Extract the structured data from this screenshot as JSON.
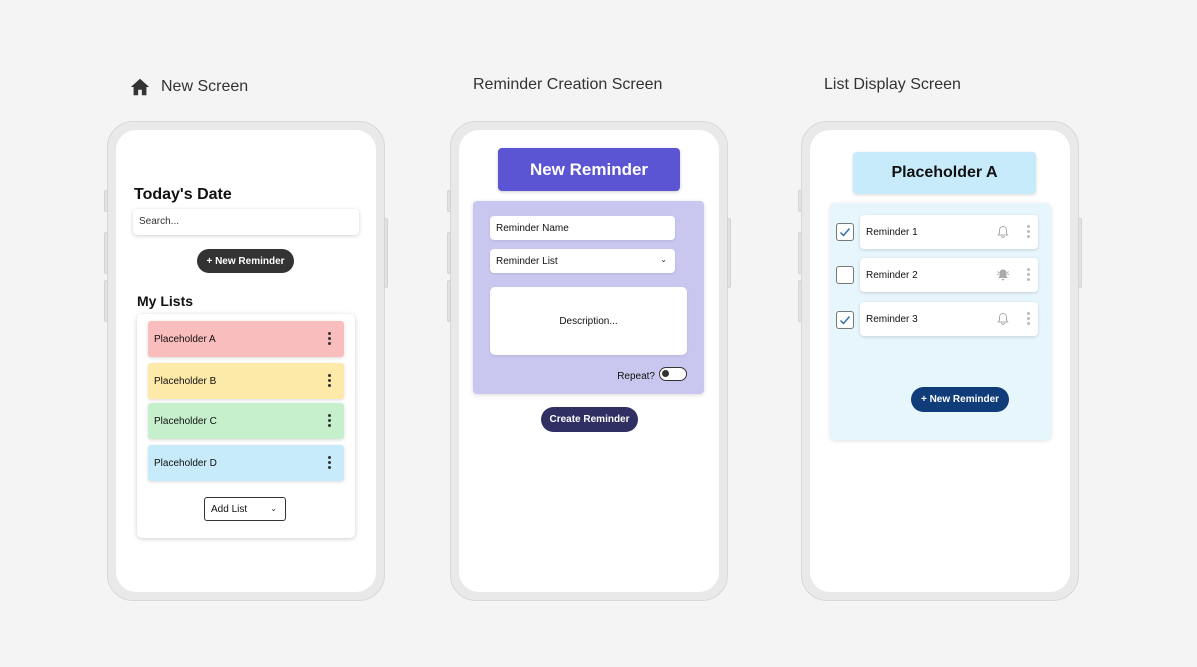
{
  "screens": {
    "home_title": "New Screen",
    "creation_title": "Reminder Creation Screen",
    "list_title": "List Display Screen"
  },
  "home": {
    "date_label": "Today's Date",
    "search_placeholder": "Search...",
    "new_reminder_button": "+ New Reminder",
    "my_lists_label": "My Lists",
    "lists": [
      {
        "label": "Placeholder A",
        "color": "#f9bdbd"
      },
      {
        "label": "Placeholder B",
        "color": "#fde9a8"
      },
      {
        "label": "Placeholder C",
        "color": "#c6f0cc"
      },
      {
        "label": "Placeholder D",
        "color": "#c8ebfb"
      }
    ],
    "add_list_label": "Add List"
  },
  "creation": {
    "header": "New Reminder",
    "name_placeholder": "Reminder Name",
    "list_select": "Reminder List",
    "description_placeholder": "Description...",
    "repeat_label": "Repeat?",
    "repeat_on": false,
    "create_button": "Create Reminder"
  },
  "list_display": {
    "header": "Placeholder A",
    "reminders": [
      {
        "label": "Reminder 1",
        "checked": true,
        "bell": "bell-icon"
      },
      {
        "label": "Reminder 2",
        "checked": false,
        "bell": "bell-ringing-icon"
      },
      {
        "label": "Reminder 3",
        "checked": true,
        "bell": "bell-icon"
      }
    ],
    "new_reminder_button": "+ New Reminder"
  },
  "colors": {
    "primary_purple": "#5b55d4",
    "form_bg": "#c9c7f0",
    "navy_button": "#2f2f63",
    "blue_button": "#103d7a",
    "list_header_bg": "#c8ebfb"
  }
}
